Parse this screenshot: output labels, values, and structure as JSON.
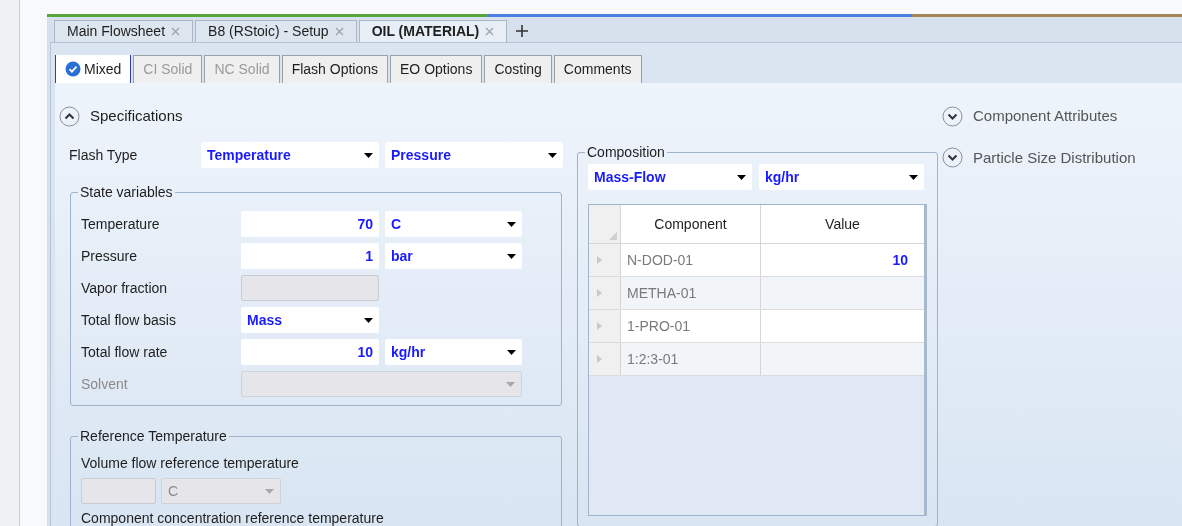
{
  "doc_tabs": [
    {
      "label": "Main Flowsheet",
      "selected": false
    },
    {
      "label": "B8 (RStoic) - Setup",
      "selected": false
    },
    {
      "label": "OIL (MATERIAL)",
      "selected": true
    }
  ],
  "form_tabs": [
    {
      "label": "Mixed",
      "selected": true,
      "disabled": false,
      "complete": true
    },
    {
      "label": "CI Solid",
      "selected": false,
      "disabled": true,
      "complete": false
    },
    {
      "label": "NC Solid",
      "selected": false,
      "disabled": true,
      "complete": false
    },
    {
      "label": "Flash Options",
      "selected": false,
      "disabled": false,
      "complete": false
    },
    {
      "label": "EO Options",
      "selected": false,
      "disabled": false,
      "complete": false
    },
    {
      "label": "Costing",
      "selected": false,
      "disabled": false,
      "complete": false
    },
    {
      "label": "Comments",
      "selected": false,
      "disabled": false,
      "complete": false
    }
  ],
  "specifications": {
    "label": "Specifications",
    "expanded": true
  },
  "flash_type": {
    "label": "Flash Type",
    "values": [
      "Temperature",
      "Pressure"
    ]
  },
  "state_variables": {
    "title": "State variables",
    "rows": [
      {
        "kind": "value_unit",
        "label": "Temperature",
        "value": "70",
        "unit": "C",
        "disabled": false
      },
      {
        "kind": "value_unit",
        "label": "Pressure",
        "value": "1",
        "unit": "bar",
        "disabled": false
      },
      {
        "kind": "field",
        "label": "Vapor fraction",
        "disabled": true
      },
      {
        "kind": "select",
        "label": "Total flow basis",
        "value": "Mass",
        "disabled": false
      },
      {
        "kind": "value_unit",
        "label": "Total flow rate",
        "value": "10",
        "unit": "kg/hr",
        "disabled": false
      },
      {
        "kind": "wide_select",
        "label": "Solvent",
        "disabled": true
      }
    ]
  },
  "reference_temperature": {
    "title": "Reference Temperature",
    "rows": [
      {
        "kind": "field_unit",
        "label": "Volume flow reference temperature",
        "unit": "C",
        "disabled": true
      },
      {
        "kind": "label",
        "label": "Component concentration reference temperature"
      }
    ]
  },
  "composition": {
    "title": "Composition",
    "basis": "Mass-Flow",
    "units": "kg/hr",
    "columns": [
      "Component",
      "Value"
    ],
    "rows": [
      {
        "component": "N-DOD-01",
        "value": "10"
      },
      {
        "component": "METHA-01"
      },
      {
        "component": "1-PRO-01"
      },
      {
        "component": "1:2:3-01"
      }
    ]
  },
  "side_sections": [
    {
      "label": "Component Attributes",
      "expanded": false
    },
    {
      "label": "Particle Size Distribution",
      "expanded": false
    }
  ]
}
